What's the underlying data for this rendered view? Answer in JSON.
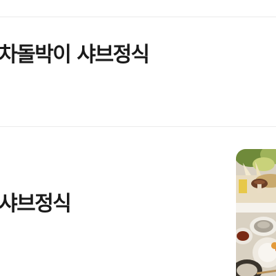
{
  "menu": {
    "items": [
      {
        "name": "차돌박이 샤브정식"
      },
      {
        "name": "샤브정식",
        "image": "shabu-set-food-photo"
      }
    ]
  }
}
